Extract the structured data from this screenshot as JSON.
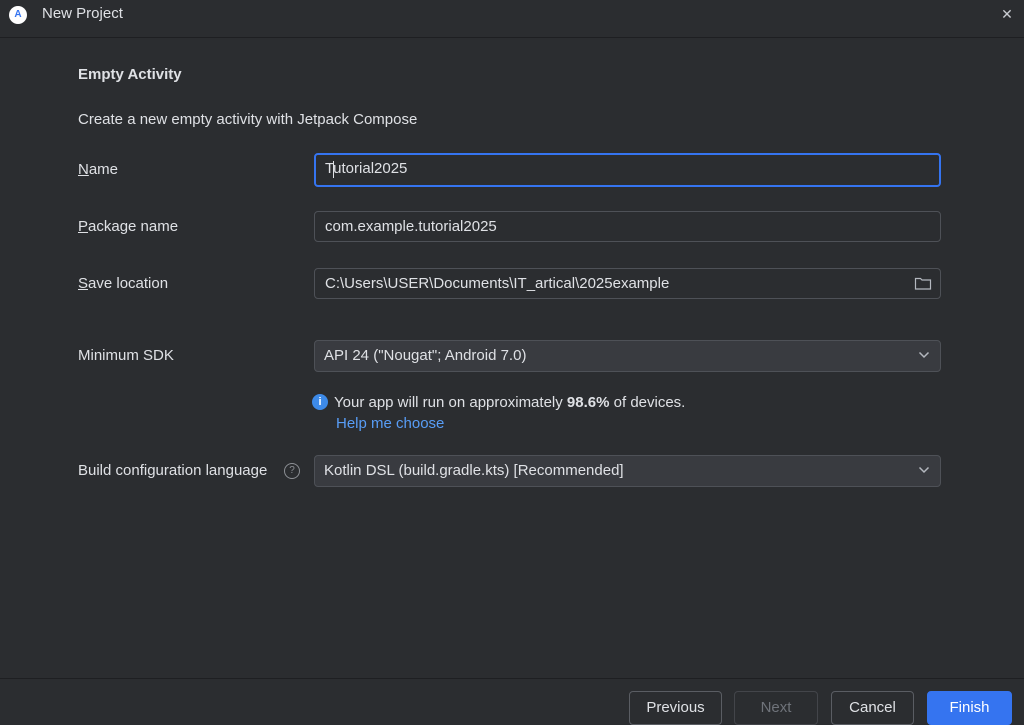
{
  "window": {
    "title": "New Project",
    "app_icon_glyph": "A",
    "close_glyph": "✕"
  },
  "template": {
    "heading": "Empty Activity",
    "description": "Create a new empty activity with Jetpack Compose"
  },
  "form": {
    "name": {
      "mnemonic": "N",
      "label_rest": "ame",
      "value_start": "T",
      "value_rest": "utorial2025"
    },
    "package": {
      "mnemonic": "P",
      "label_rest": "ackage name",
      "value": "com.example.tutorial2025"
    },
    "save_location": {
      "mnemonic": "S",
      "label_rest": "ave location",
      "value": "C:\\Users\\USER\\Documents\\IT_artical\\2025example"
    },
    "min_sdk": {
      "label": "Minimum SDK",
      "value": "API 24 (\"Nougat\"; Android 7.0)"
    },
    "info": {
      "icon_glyph": "i",
      "prefix": "Your app will run on approximately ",
      "percent": "98.6%",
      "suffix": " of devices.",
      "link": "Help me choose"
    },
    "build_lang": {
      "label": "Build configuration language",
      "help_glyph": "?",
      "value": "Kotlin DSL (build.gradle.kts) [Recommended]"
    }
  },
  "buttons": {
    "previous": "Previous",
    "next": "Next",
    "cancel": "Cancel",
    "finish": "Finish"
  },
  "icons": {
    "app": "android-studio-icon",
    "close": "close-icon",
    "folder": "folder-icon",
    "chevron": "chevron-down-icon",
    "info": "info-icon",
    "help": "question-icon"
  },
  "colors": {
    "background": "#2b2d30",
    "accent": "#3574f0",
    "link": "#589df6",
    "text": "#dfe1e5"
  }
}
